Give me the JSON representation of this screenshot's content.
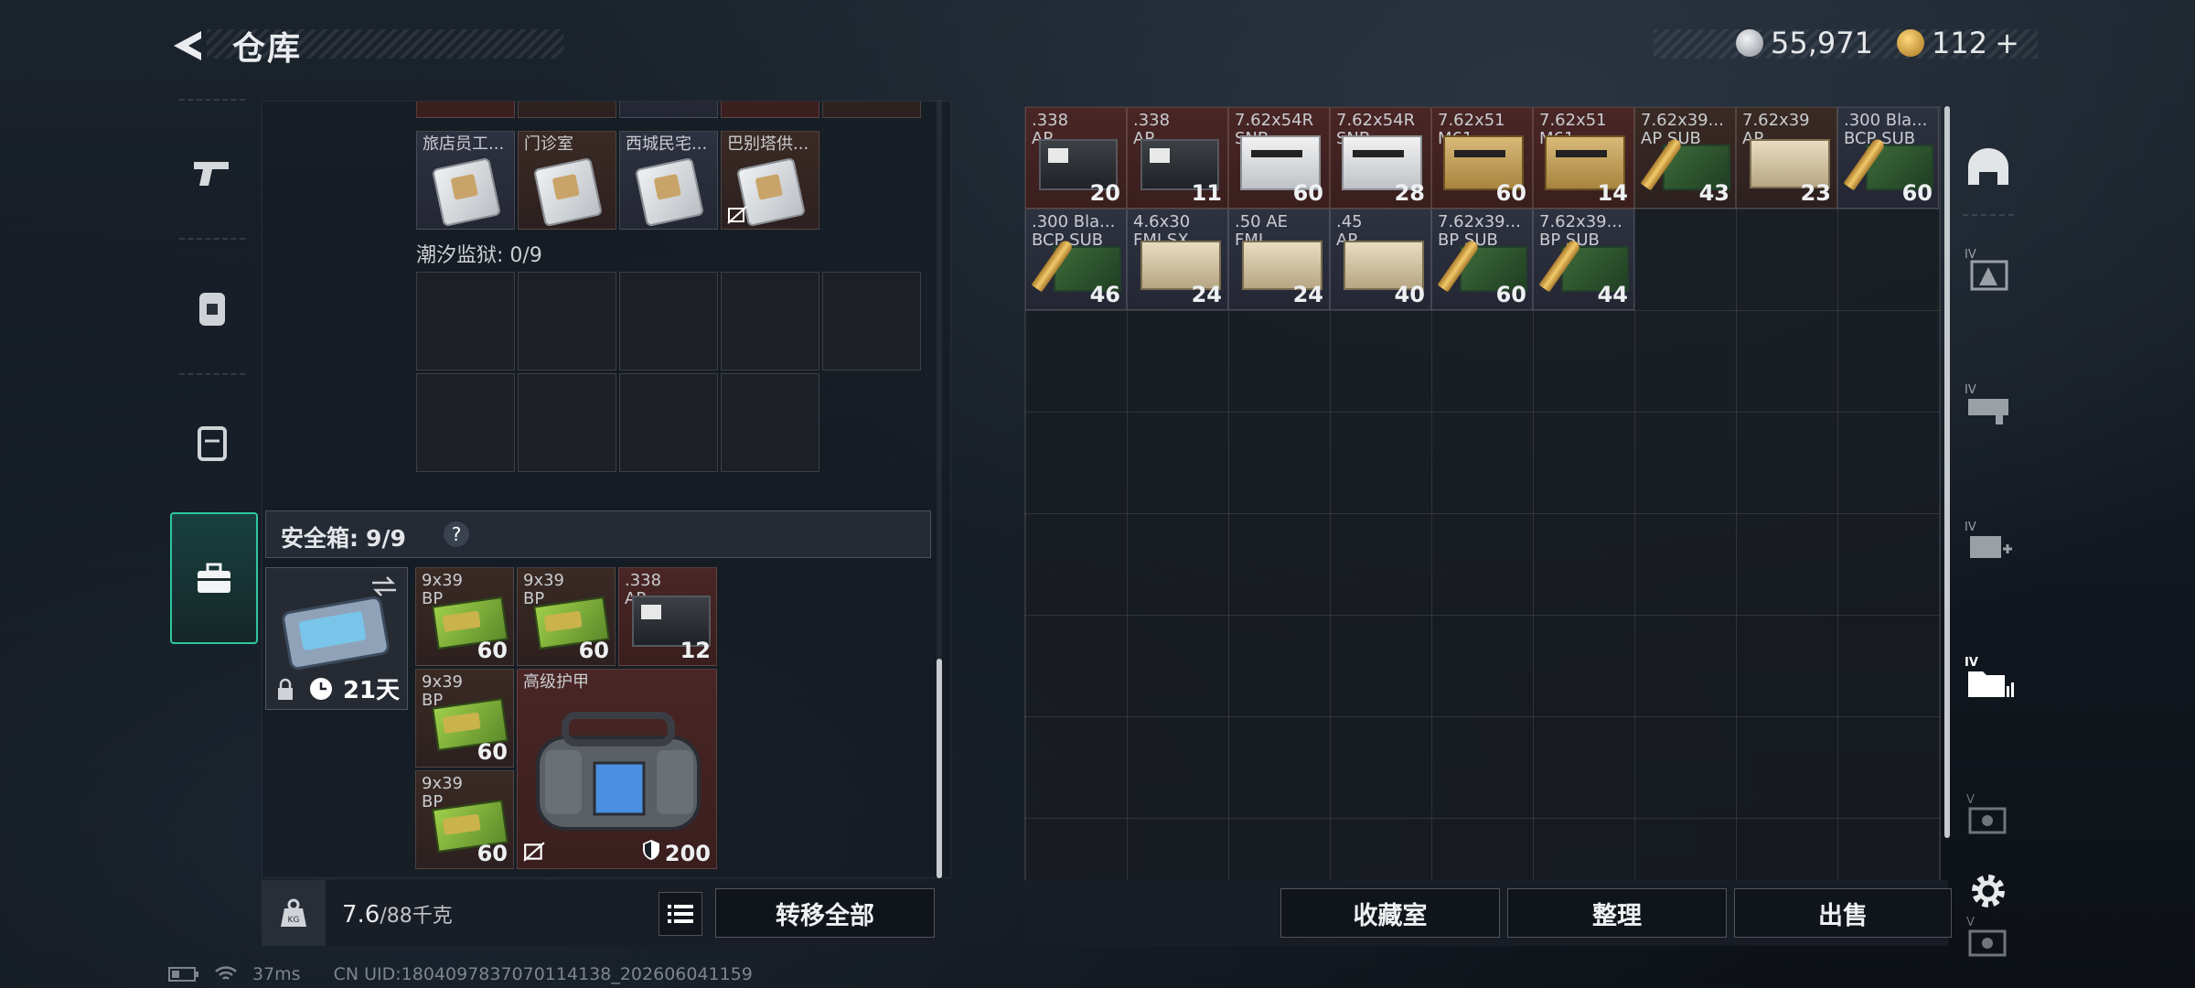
{
  "header": {
    "title": "仓库",
    "currency": [
      {
        "icon": "silver-coin-icon",
        "value": "55,971",
        "color": "#c9ccd0"
      },
      {
        "icon": "gold-triangle-coin-icon",
        "value": "112",
        "plus": "+",
        "color": "#d8a53a"
      }
    ]
  },
  "left_tabs": [
    {
      "name": "weapons",
      "icon": "pistol-icon"
    },
    {
      "name": "equipment",
      "icon": "vest-icon"
    },
    {
      "name": "backpack",
      "icon": "backpack-icon"
    },
    {
      "name": "safe-box",
      "icon": "toolbox-icon",
      "active": true
    }
  ],
  "keycards": [
    {
      "label": "旅店员工..."
    },
    {
      "label": "门诊室"
    },
    {
      "label": "西城民宅..."
    },
    {
      "label": "巴别塔供..."
    }
  ],
  "tide_prison": {
    "label": "潮汐监狱: 0/9"
  },
  "safe_box": {
    "label": "安全箱:",
    "count": "9/9",
    "help": "?",
    "days": "21天",
    "items": [
      {
        "label": "9x39\nBP",
        "qty": "60"
      },
      {
        "label": "9x39\nBP",
        "qty": "60"
      },
      {
        "label": ".338\nAP",
        "qty": "12"
      },
      {
        "label": "9x39\nBP",
        "qty": "60"
      },
      {
        "label": "9x39\nBP",
        "qty": "60"
      },
      {
        "label": "高级护甲",
        "qty": "200"
      }
    ]
  },
  "weight": {
    "current": "7.6",
    "max": "/88千克"
  },
  "buttons": {
    "transfer_all": "转移全部",
    "collection": "收藏室",
    "organize": "整理",
    "sell": "出售"
  },
  "stash_items": [
    {
      "label": ".338\nAP",
      "qty": "20",
      "bg": "red",
      "art": "dark"
    },
    {
      "label": ".338\nAP",
      "qty": "11",
      "bg": "red",
      "art": "dark"
    },
    {
      "label": "7.62x54R\nSNB",
      "qty": "60",
      "bg": "red",
      "art": "white"
    },
    {
      "label": "7.62x54R\nSNB",
      "qty": "28",
      "bg": "red",
      "art": "white"
    },
    {
      "label": "7.62x51\nM61",
      "qty": "60",
      "bg": "red",
      "art": "tan"
    },
    {
      "label": "7.62x51\nM61",
      "qty": "14",
      "bg": "red",
      "art": "tan"
    },
    {
      "label": "7.62x39...\nAP SUB",
      "qty": "43",
      "bg": "brown",
      "art": "bullet"
    },
    {
      "label": "7.62x39\nAP",
      "qty": "23",
      "bg": "brown",
      "art": "beige"
    },
    {
      "label": ".300 Bla...\nBCP SUB",
      "qty": "60",
      "bg": "gray",
      "art": "bullet"
    },
    {
      "label": ".300 Bla...\nBCP SUB",
      "qty": "46",
      "bg": "gray",
      "art": "bullet"
    },
    {
      "label": "4.6x30\nFMJ SX",
      "qty": "24",
      "bg": "gray",
      "art": "beige"
    },
    {
      "label": ".50 AE\nFMJ",
      "qty": "24",
      "bg": "gray",
      "art": "beige"
    },
    {
      "label": ".45\nAP",
      "qty": "40",
      "bg": "gray",
      "art": "beige"
    },
    {
      "label": "7.62x39...\nBP SUB",
      "qty": "60",
      "bg": "gray",
      "art": "bullet"
    },
    {
      "label": "7.62x39...\nBP SUB",
      "qty": "44",
      "bg": "gray",
      "art": "bullet"
    }
  ],
  "right_rail": [
    {
      "icon": "helmet-icon",
      "tier": ""
    },
    {
      "icon": "armor-rig-icon",
      "tier": "IV"
    },
    {
      "icon": "weapon-crate-icon",
      "tier": "IV"
    },
    {
      "icon": "medkit-icon",
      "tier": "IV"
    },
    {
      "icon": "folder-icon",
      "tier": "IV",
      "active": true
    },
    {
      "icon": "safe-icon",
      "tier": "V"
    },
    {
      "icon": "safe-icon",
      "tier": "V"
    },
    {
      "icon": "settings-gear-icon",
      "tier": ""
    }
  ],
  "status": {
    "ping": "37ms",
    "uid": "CN UID:1804097837070114138_202606041159"
  }
}
